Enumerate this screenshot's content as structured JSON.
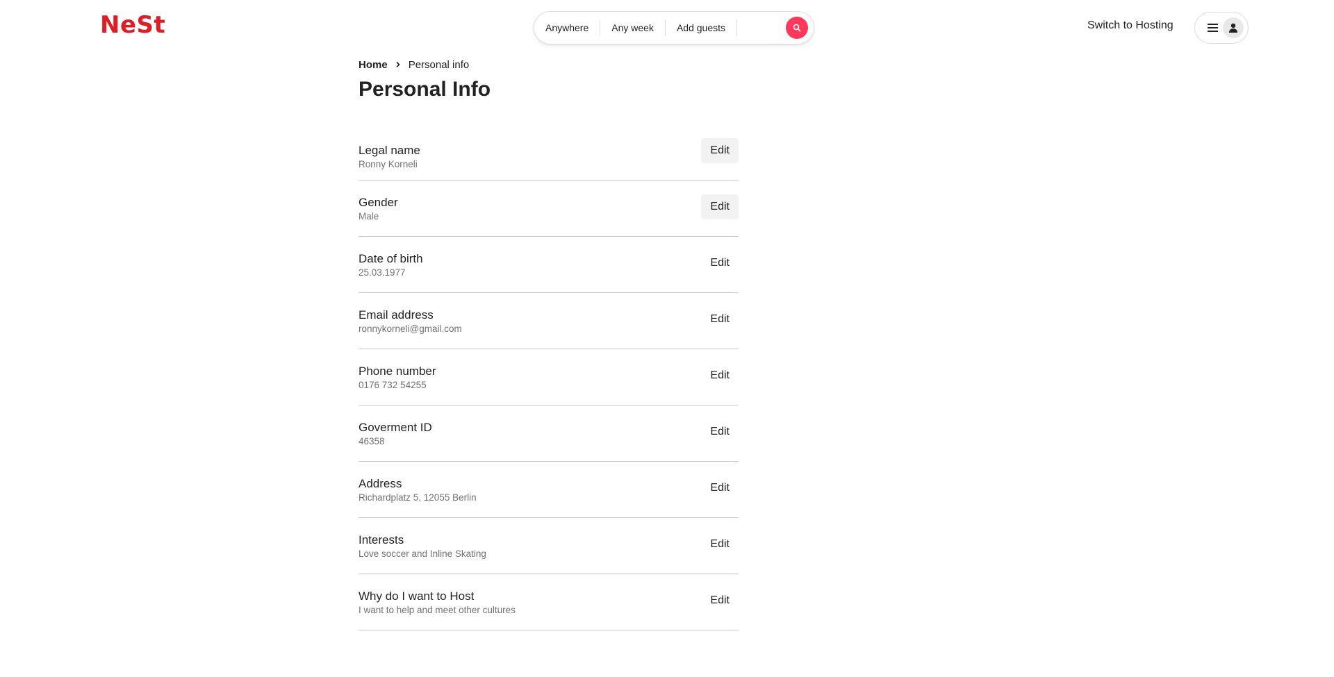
{
  "header": {
    "logo": "NeSt",
    "search": {
      "location": "Anywhere",
      "week": "Any week",
      "guests": "Add guests",
      "search_icon": "search-icon",
      "accent_color": "#ff385c"
    },
    "switch_hosting": "Switch to Hosting",
    "menu_icon": "hamburger-icon",
    "avatar_icon": "user-icon"
  },
  "breadcrumb": {
    "home": "Home",
    "separator_icon": "chevron-right-icon",
    "current": "Personal info"
  },
  "page_title": "Personal Info",
  "fields": [
    {
      "label": "Legal name",
      "value": "Ronny Korneli",
      "edit": "Edit"
    },
    {
      "label": "Gender",
      "value": "Male",
      "edit": "Edit"
    },
    {
      "label": "Date of birth",
      "value": "25.03.1977",
      "edit": "Edit"
    },
    {
      "label": "Email address",
      "value": "ronnykorneli@gmail.com",
      "edit": "Edit"
    },
    {
      "label": "Phone number",
      "value": "0176 732 54255",
      "edit": "Edit"
    },
    {
      "label": "Goverment ID",
      "value": "46358",
      "edit": "Edit"
    },
    {
      "label": "Address",
      "value": "Richardplatz 5, 12055 Berlin",
      "edit": "Edit"
    },
    {
      "label": "Interests",
      "value": "Love soccer and Inline Skating",
      "edit": "Edit"
    },
    {
      "label": "Why do I want to Host",
      "value": "I want to help and meet other cultures",
      "edit": "Edit"
    }
  ],
  "colors": {
    "brand": "#e31b23",
    "text": "#222222",
    "muted": "#717171",
    "divider": "#c8c8c8"
  }
}
